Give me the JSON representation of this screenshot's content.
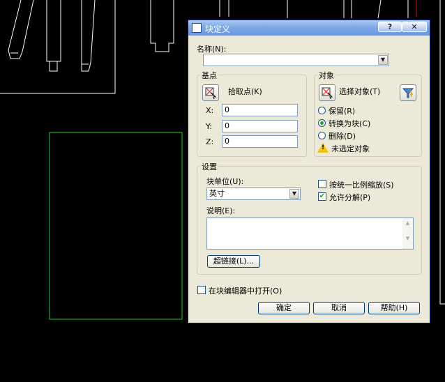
{
  "dialog": {
    "title": "块定义",
    "help_button": "?",
    "close_button": "✕",
    "name_label": "名称(N):",
    "name_value": "",
    "base_point": {
      "legend": "基点",
      "pick_label": "拾取点(K)",
      "x_label": "X:",
      "x_value": "0",
      "y_label": "Y:",
      "y_value": "0",
      "z_label": "Z:",
      "z_value": "0"
    },
    "objects": {
      "legend": "对象",
      "select_label": "选择对象(T)",
      "retain": "保留(R)",
      "convert": "转换为块(C)",
      "delete": "删除(D)",
      "selected": "convert",
      "warning": "未选定对象"
    },
    "settings": {
      "legend": "设置",
      "unit_label": "块单位(U):",
      "unit_value": "英寸",
      "scale_uniform": "按统一比例缩放(S)",
      "scale_uniform_checked": false,
      "allow_explode": "允许分解(P)",
      "allow_explode_checked": true,
      "desc_label": "说明(E):",
      "desc_value": "",
      "hyperlink": "超链接(L)..."
    },
    "open_in_editor": "在块编辑器中打开(O)",
    "open_in_editor_checked": false,
    "ok": "确定",
    "cancel": "取消",
    "help": "帮助(H)"
  }
}
